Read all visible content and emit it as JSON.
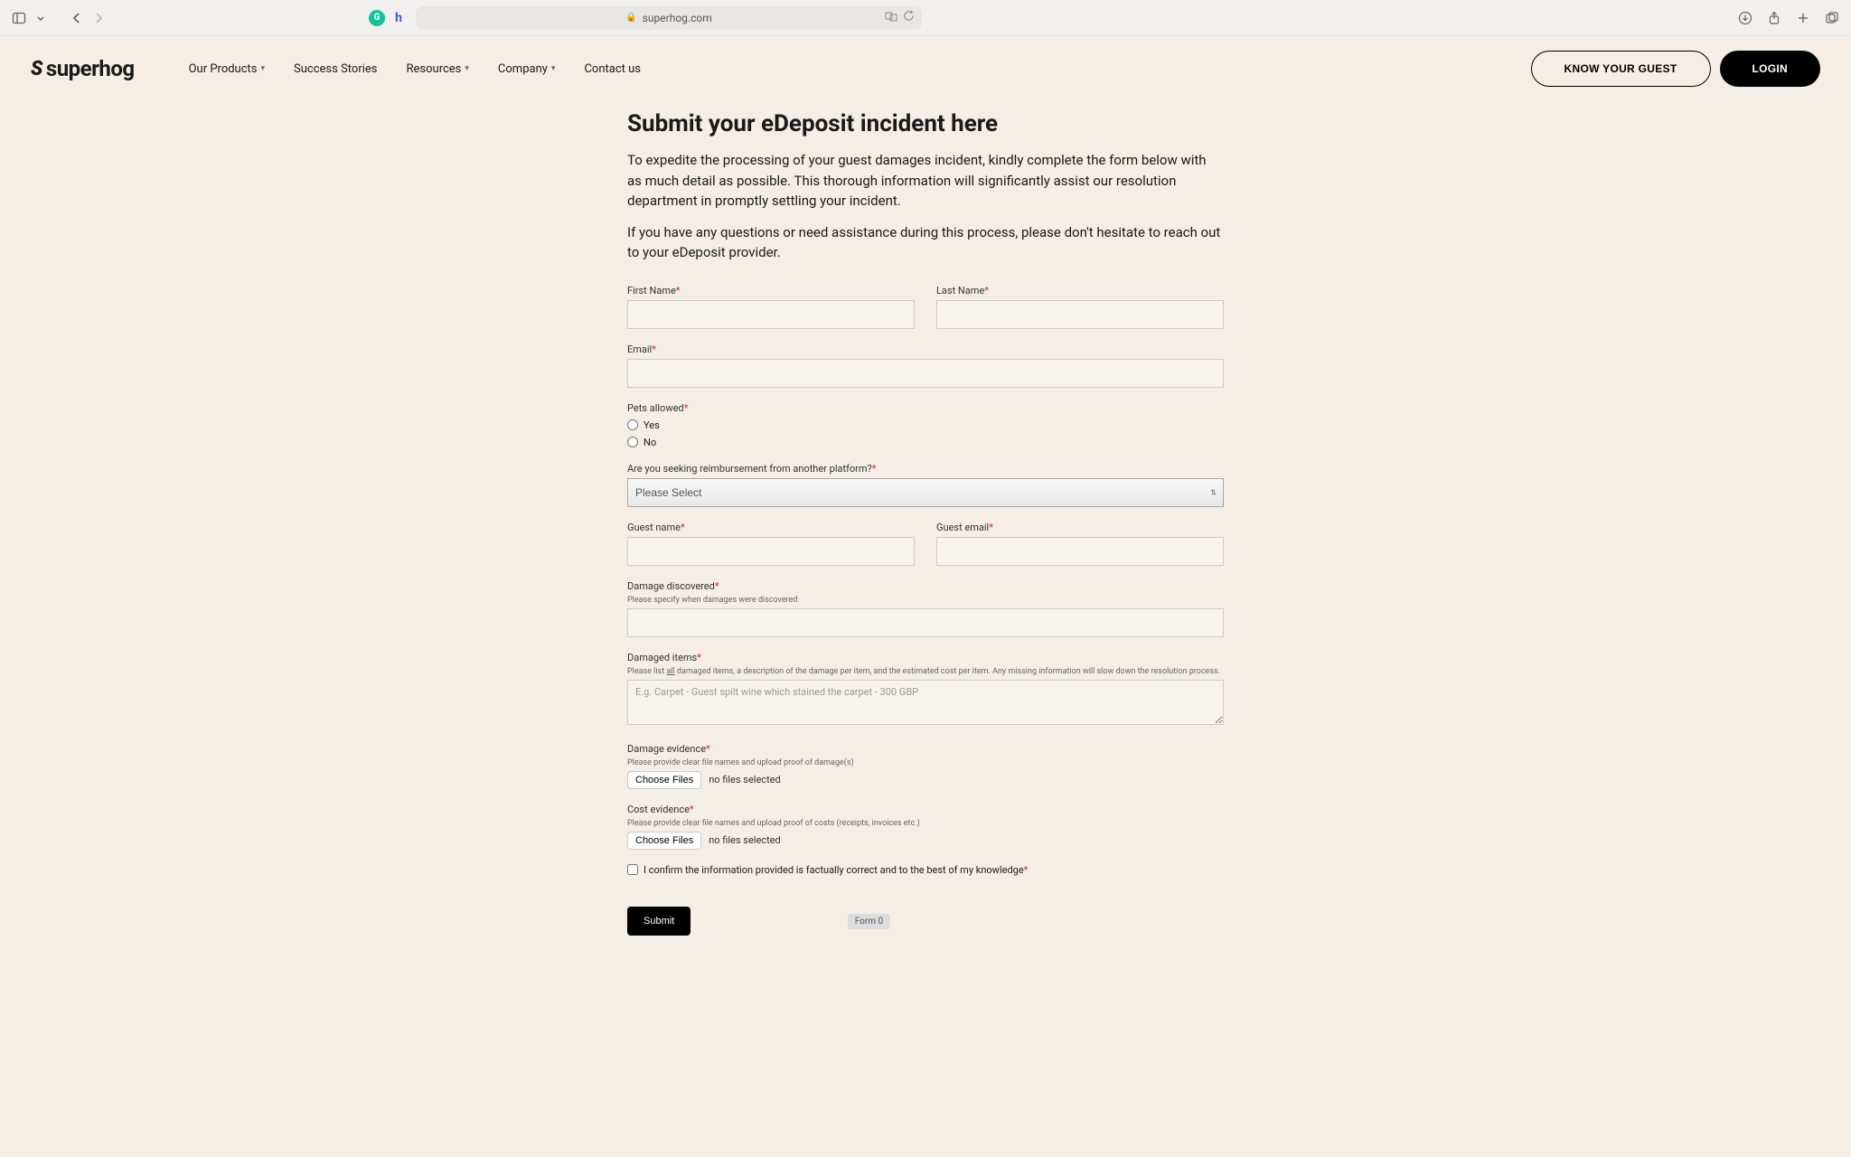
{
  "browser": {
    "url": "superhog.com"
  },
  "extensions": {
    "grammarly": "G",
    "honey": "h"
  },
  "logo": {
    "text": "superhog"
  },
  "nav": {
    "products": "Our Products",
    "success": "Success Stories",
    "resources": "Resources",
    "company": "Company",
    "contact": "Contact us"
  },
  "header": {
    "know_guest": "KNOW YOUR GUEST",
    "login": "LOGIN"
  },
  "heading": "Submit your eDeposit incident here",
  "intro": {
    "p1": "To expedite the processing of your guest damages incident, kindly complete the form below with as much detail as possible. This thorough information will significantly assist our resolution department in promptly settling your incident.",
    "p2": "If you have any questions or need assistance during this process, please don't hesitate to reach out to your eDeposit provider."
  },
  "form": {
    "first_name_label": "First Name",
    "last_name_label": "Last Name",
    "email_label": "Email",
    "pets_label": "Pets allowed",
    "pets_yes": "Yes",
    "pets_no": "No",
    "reimbursement_label": "Are you seeking reimbursement from another platform?",
    "reimbursement_selected": "Please Select",
    "guest_name_label": "Guest name",
    "guest_email_label": "Guest email",
    "damage_discovered_label": "Damage discovered",
    "damage_discovered_hint": "Please specify when damages were discovered",
    "damaged_items_label": "Damaged items",
    "damaged_items_hint_prefix": "Please list ",
    "damaged_items_hint_all": "all",
    "damaged_items_hint_suffix": " damaged items, a description of the damage per item, and the estimated cost per item. Any missing information will slow down the resolution process.",
    "damaged_items_placeholder": "E.g. Carpet - Guest spilt wine which stained the carpet - 300 GBP",
    "damage_evidence_label": "Damage evidence",
    "damage_evidence_hint": "Please provide clear file names and upload proof of damage(s)",
    "cost_evidence_label": "Cost evidence",
    "cost_evidence_hint": "Please provide clear file names and upload proof of costs (receipts, invoices etc.)",
    "choose_files": "Choose Files",
    "no_files": "no files selected",
    "confirm_label": "I confirm the information provided is factually correct and to the best of my knowledge",
    "submit": "Submit",
    "badge": "Form 0"
  },
  "asterisk": "*"
}
